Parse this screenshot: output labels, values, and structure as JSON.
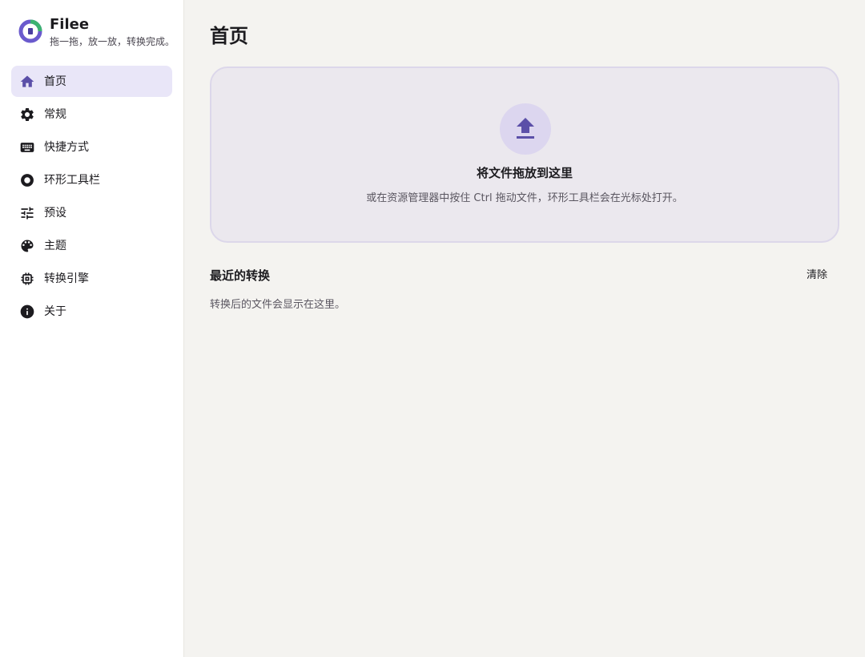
{
  "app": {
    "name": "Filee",
    "tagline": "拖一拖，放一放，转换完成。"
  },
  "sidebar": {
    "items": [
      {
        "label": "首页",
        "icon": "home-icon",
        "active": true
      },
      {
        "label": "常规",
        "icon": "gear-icon",
        "active": false
      },
      {
        "label": "快捷方式",
        "icon": "keyboard-icon",
        "active": false
      },
      {
        "label": "环形工具栏",
        "icon": "ring-icon",
        "active": false
      },
      {
        "label": "预设",
        "icon": "sliders-icon",
        "active": false
      },
      {
        "label": "主题",
        "icon": "palette-icon",
        "active": false
      },
      {
        "label": "转换引擎",
        "icon": "chip-icon",
        "active": false
      },
      {
        "label": "关于",
        "icon": "info-icon",
        "active": false
      }
    ]
  },
  "main": {
    "title": "首页",
    "dropzone": {
      "icon": "upload-icon",
      "title": "将文件拖放到这里",
      "hint": "或在资源管理器中按住 Ctrl 拖动文件，环形工具栏会在光标处打开。"
    },
    "recent": {
      "title": "最近的转换",
      "clear_label": "清除",
      "empty_text": "转换后的文件会显示在这里。"
    }
  },
  "colors": {
    "accent": "#5b4fa8",
    "active_bg": "#e9e6f8",
    "dropzone_bg": "#ebe8ee",
    "page_bg": "#f4f3f0"
  }
}
